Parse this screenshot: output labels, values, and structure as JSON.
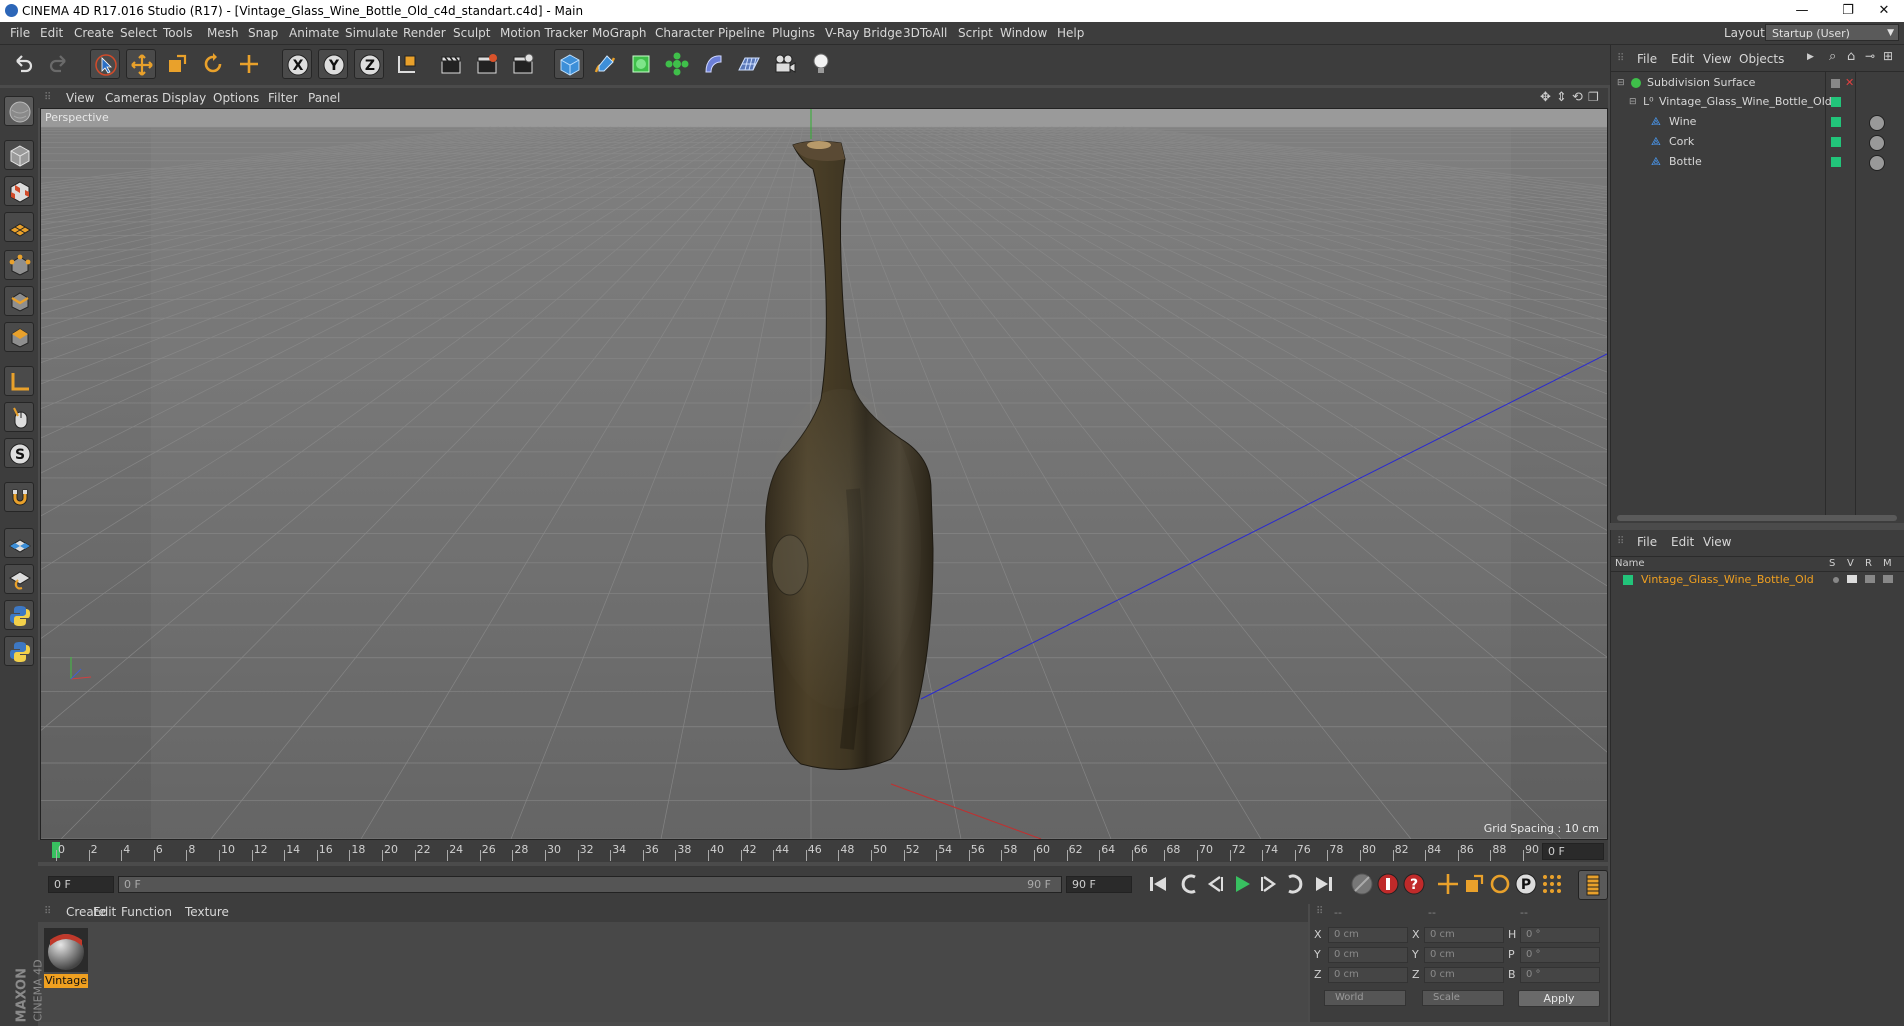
{
  "window": {
    "title": "CINEMA 4D R17.016 Studio (R17) - [Vintage_Glass_Wine_Bottle_Old_c4d_standart.c4d] - Main",
    "minimize": "—",
    "maximize": "❐",
    "close": "✕"
  },
  "menu": [
    "File",
    "Edit",
    "Create",
    "Select",
    "Tools",
    "Mesh",
    "Snap",
    "Animate",
    "Simulate",
    "Render",
    "Sculpt",
    "Motion Tracker",
    "MoGraph",
    "Character",
    "Pipeline",
    "Plugins",
    "V-Ray Bridge",
    "3DToAll",
    "Script",
    "Window",
    "Help"
  ],
  "layout": {
    "label": "Layout:",
    "value": "Startup (User)"
  },
  "viewport": {
    "menu": [
      "View",
      "Cameras",
      "Display",
      "Options",
      "Filter",
      "Panel"
    ],
    "label": "Perspective",
    "grid_spacing": "Grid Spacing : 10 cm"
  },
  "timeline": {
    "ticks": [
      "0",
      "2",
      "4",
      "6",
      "8",
      "10",
      "12",
      "14",
      "16",
      "18",
      "20",
      "22",
      "24",
      "26",
      "28",
      "30",
      "32",
      "34",
      "36",
      "38",
      "40",
      "42",
      "44",
      "46",
      "48",
      "50",
      "52",
      "54",
      "56",
      "58",
      "60",
      "62",
      "64",
      "66",
      "68",
      "70",
      "72",
      "74",
      "76",
      "78",
      "80",
      "82",
      "84",
      "86",
      "88",
      "90"
    ],
    "end_field": "0 F",
    "current_frame": "0 F",
    "range_start": "0 F",
    "range_end": "90 F",
    "max_frame": "90 F"
  },
  "material_manager": {
    "menu": [
      "Create",
      "Edit",
      "Function",
      "Texture"
    ],
    "materials": [
      {
        "name": "Vintage"
      }
    ]
  },
  "coordinates": {
    "headers": [
      "--",
      "--",
      "--"
    ],
    "rows": [
      {
        "a": "X",
        "a_val": "0 cm",
        "b": "X",
        "b_val": "0 cm",
        "c": "H",
        "c_val": "0 °"
      },
      {
        "a": "Y",
        "a_val": "0 cm",
        "b": "Y",
        "b_val": "0 cm",
        "c": "P",
        "c_val": "0 °"
      },
      {
        "a": "Z",
        "a_val": "0 cm",
        "b": "Z",
        "b_val": "0 cm",
        "c": "B",
        "c_val": "0 °"
      }
    ],
    "mode_world": "World",
    "mode_scale": "Scale",
    "apply": "Apply"
  },
  "object_manager": {
    "menu": [
      "File",
      "Edit",
      "View",
      "Objects"
    ],
    "objects": [
      {
        "name": "Subdivision Surface",
        "level": 0
      },
      {
        "name": "Vintage_Glass_Wine_Bottle_Old",
        "level": 1
      },
      {
        "name": "Wine",
        "level": 2
      },
      {
        "name": "Cork",
        "level": 2
      },
      {
        "name": "Bottle",
        "level": 2
      }
    ]
  },
  "attribute_manager": {
    "menu": [
      "File",
      "Edit",
      "View"
    ],
    "columns": {
      "name": "Name",
      "s": "S",
      "v": "V",
      "r": "R",
      "m": "M"
    },
    "layer": "Vintage_Glass_Wine_Bottle_Old"
  },
  "brand": {
    "line1": "MAXON",
    "line2": "CINEMA 4D"
  },
  "colors": {
    "accent": "#f0a020",
    "layer_green": "#22c47a",
    "panel": "#3d3d3d",
    "viewport_sky": "#8a8a8a"
  }
}
